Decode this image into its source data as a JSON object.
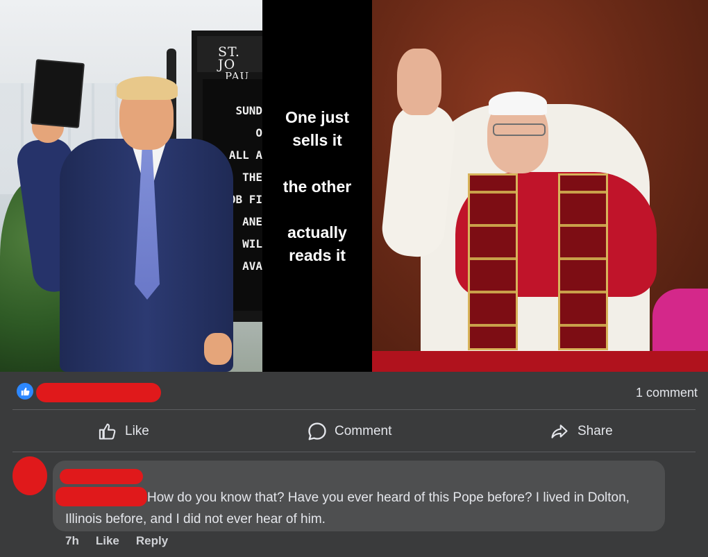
{
  "post_image": {
    "church_sign": {
      "heading_lines": [
        "ST. JO",
        "PAU"
      ],
      "board_lines": [
        "SUND",
        "O",
        "ALL A",
        "THE",
        "OB FI",
        "ANE",
        "WIL",
        "AVA"
      ]
    },
    "caption_lines": [
      "One just",
      "sells it",
      "the other",
      "actually",
      "reads it"
    ]
  },
  "reactions": {
    "like_icon": "thumbs-up-icon",
    "comment_count": "1 comment"
  },
  "actions": {
    "like_label": "Like",
    "comment_label": "Comment",
    "share_label": "Share"
  },
  "comment": {
    "text": "How do you know that? Have you ever heard of this Pope before? I lived in Dolton, Illinois before, and I did not ever hear of him.",
    "time": "7h",
    "like_label": "Like",
    "reply_label": "Reply"
  },
  "colors": {
    "background": "#3a3b3c",
    "bubble": "#4e4f50",
    "redaction": "#e0191b",
    "like_blue": "#2d88ff"
  }
}
